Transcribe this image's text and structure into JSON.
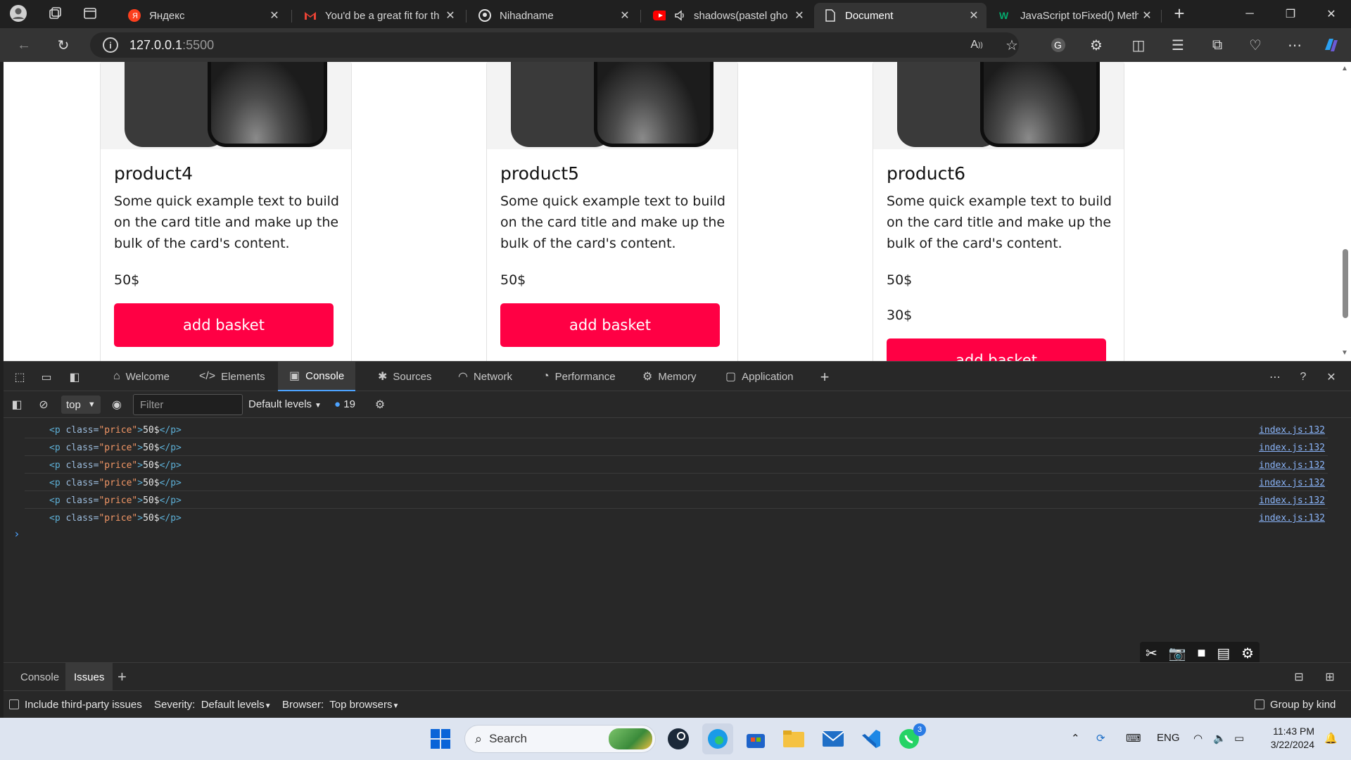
{
  "browser": {
    "tabs": [
      {
        "title": "Яндекс",
        "favicon": "yandex-icon"
      },
      {
        "title": "You'd be a great fit for th",
        "favicon": "gmail-icon"
      },
      {
        "title": "Nihadname",
        "favicon": "github-icon"
      },
      {
        "title": "shadows(pastel gho",
        "favicon": "youtube-icon"
      },
      {
        "title": "Document",
        "favicon": "document-icon"
      },
      {
        "title": "JavaScript toFixed() Meth",
        "favicon": "w3schools-icon"
      }
    ],
    "new_tab_label": "+",
    "address": {
      "host": "127.0.0.1",
      "port": ":5500"
    }
  },
  "page": {
    "products": [
      {
        "title": "product4",
        "text": "Some quick example text to build on the card title and make up the bulk of the card's content.",
        "prices": [
          "50$"
        ],
        "button": "add basket"
      },
      {
        "title": "product5",
        "text": "Some quick example text to build on the card title and make up the bulk of the card's content.",
        "prices": [
          "50$"
        ],
        "button": "add basket"
      },
      {
        "title": "product6",
        "text": "Some quick example text to build on the card title and make up the bulk of the card's content.",
        "prices": [
          "50$",
          "30$"
        ],
        "button": "add basket"
      }
    ]
  },
  "devtools": {
    "tabs": [
      {
        "label": "Welcome",
        "icon": "home-icon"
      },
      {
        "label": "Elements",
        "icon": "code-icon"
      },
      {
        "label": "Console",
        "icon": "console-icon"
      },
      {
        "label": "Sources",
        "icon": "bug-icon"
      },
      {
        "label": "Network",
        "icon": "wifi-icon"
      },
      {
        "label": "Performance",
        "icon": "performance-icon"
      },
      {
        "label": "Memory",
        "icon": "memory-icon"
      },
      {
        "label": "Application",
        "icon": "application-icon"
      }
    ],
    "console": {
      "context": "top",
      "filter_placeholder": "Filter",
      "levels": "Default levels",
      "message_count": "19",
      "messages": [
        {
          "tag": "p",
          "attr": "class",
          "value": "\"price\"",
          "content": "50$",
          "source": "index.js:132"
        },
        {
          "tag": "p",
          "attr": "class",
          "value": "\"price\"",
          "content": "50$",
          "source": "index.js:132"
        },
        {
          "tag": "p",
          "attr": "class",
          "value": "\"price\"",
          "content": "50$",
          "source": "index.js:132"
        },
        {
          "tag": "p",
          "attr": "class",
          "value": "\"price\"",
          "content": "50$",
          "source": "index.js:132"
        },
        {
          "tag": "p",
          "attr": "class",
          "value": "\"price\"",
          "content": "50$",
          "source": "index.js:132"
        },
        {
          "tag": "p",
          "attr": "class",
          "value": "\"price\"",
          "content": "50$",
          "source": "index.js:132"
        }
      ]
    },
    "drawer": {
      "tabs": [
        "Console",
        "Issues"
      ],
      "include_third_party": "Include third-party issues",
      "severity_label": "Severity:",
      "severity_value": "Default levels",
      "browser_label": "Browser:",
      "browser_value": "Top browsers",
      "group_by_kind": "Group by kind"
    }
  },
  "taskbar": {
    "search_label": "Search",
    "language": "ENG",
    "time": "11:43 PM",
    "date": "3/22/2024",
    "whatsapp_badge": "3"
  },
  "colors": {
    "accent_button": "#ff0044",
    "devtools_accent": "#4da3ff"
  }
}
